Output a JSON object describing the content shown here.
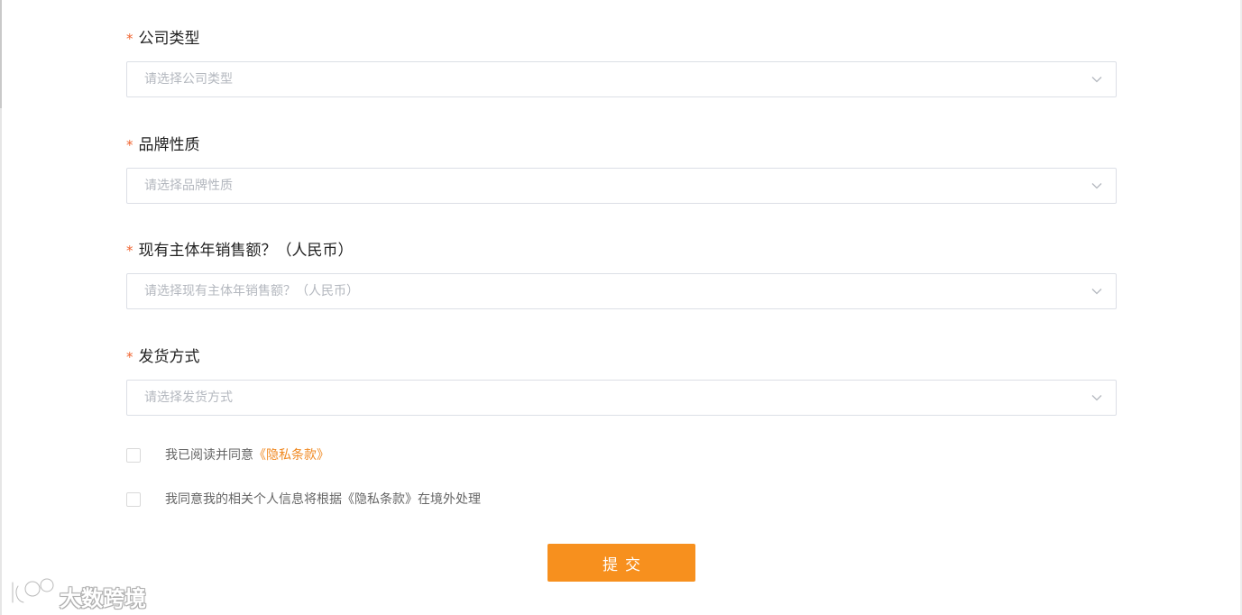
{
  "form": {
    "fields": [
      {
        "required_mark": "*",
        "label": "公司类型",
        "placeholder": "请选择公司类型"
      },
      {
        "required_mark": "*",
        "label": "品牌性质",
        "placeholder": "请选择品牌性质"
      },
      {
        "required_mark": "*",
        "label": "现有主体年销售额？（人民币）",
        "placeholder": "请选择现有主体年销售额？（人民币）"
      },
      {
        "required_mark": "*",
        "label": "发货方式",
        "placeholder": "请选择发货方式"
      }
    ],
    "agreements": [
      {
        "checked": false,
        "text": "我已阅读并同意",
        "link": "《隐私条款》"
      },
      {
        "checked": false,
        "text": "我同意我的相关个人信息将根据《隐私条款》在境外处理"
      }
    ],
    "submit_label": "提交"
  },
  "watermark": {
    "logo_text": "大数跨境"
  },
  "colors": {
    "required": "#f0632f",
    "link": "#f08a24",
    "button": "#f7901e",
    "border": "#dcdfe6",
    "placeholder": "#b4b8bf"
  },
  "icons": {
    "select_arrow": "chevron-down-icon"
  }
}
